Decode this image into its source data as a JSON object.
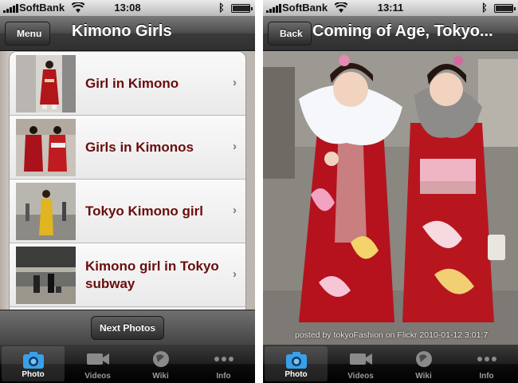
{
  "status": {
    "carrier": "SoftBank",
    "left_time": "13:08",
    "right_time": "13:11"
  },
  "left": {
    "nav": {
      "back_label": "Menu",
      "title": "Kimono Girls"
    },
    "rows": [
      {
        "label": "Girl in Kimono"
      },
      {
        "label": "Girls in Kimonos"
      },
      {
        "label": "Tokyo Kimono girl"
      },
      {
        "label": "Kimono girl in Tokyo subway"
      }
    ],
    "next_label": "Next Photos"
  },
  "right": {
    "nav": {
      "back_label": "Back",
      "title": "Coming of Age, Tokyo..."
    },
    "caption": "posted by tokyoFashion on Flickr 2010-01-12 3:01:7"
  },
  "tabs": [
    {
      "label": "Photo",
      "icon": "camera-icon"
    },
    {
      "label": "Videos",
      "icon": "video-camera-icon"
    },
    {
      "label": "Wiki",
      "icon": "globe-icon"
    },
    {
      "label": "Info",
      "icon": "more-icon"
    }
  ],
  "colors": {
    "row_text": "#6b0c0c",
    "bar_dark": "#2f2f2f"
  }
}
